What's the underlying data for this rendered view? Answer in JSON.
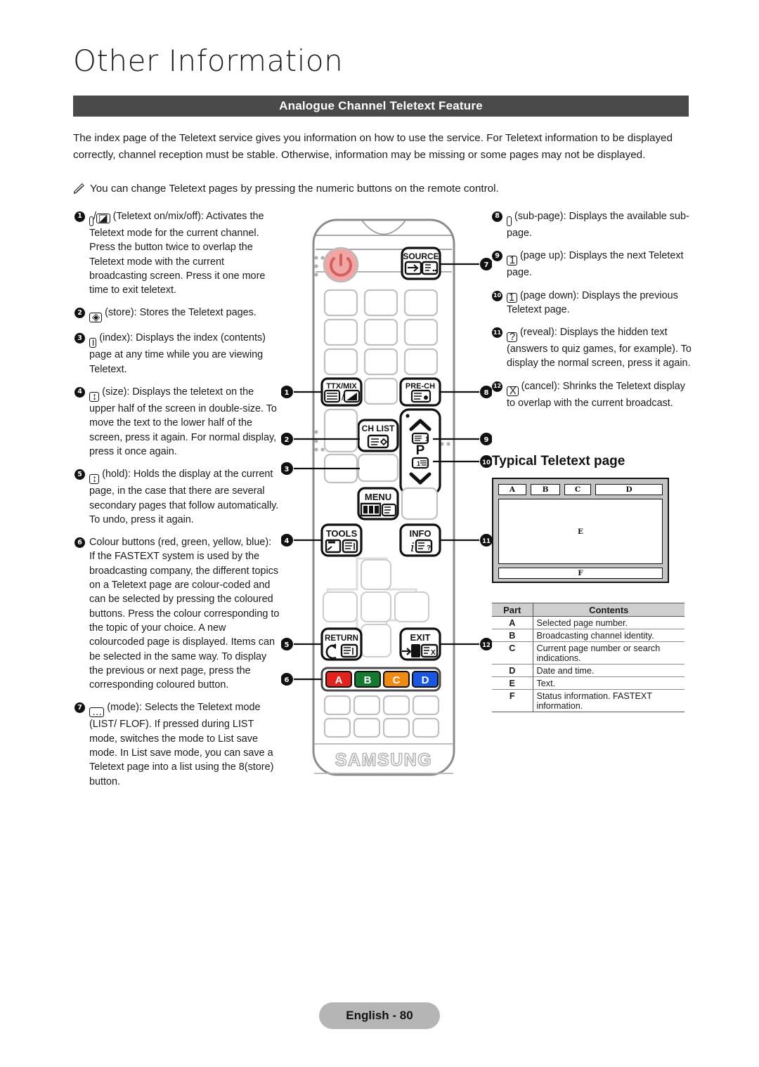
{
  "header": {
    "chapter_title": "Other Information",
    "section_title": "Analogue Channel Teletext Feature"
  },
  "intro": {
    "paragraph": "The index page of the Teletext service gives you information on how to use the service. For Teletext information to be displayed correctly, channel reception must be stable. Otherwise, information may be missing or some pages may not be displayed.",
    "note": "You can change Teletext pages by pressing the numeric buttons on the remote control.",
    "note_icon": "pencil-icon"
  },
  "left_column": [
    {
      "num": "1",
      "icon": "teletext-on-mix-off-icon",
      "text": "(Teletext on/mix/off): Activates the Teletext mode for the current channel. Press the button twice to overlap the Teletext mode with the current broadcasting screen. Press it one more time to exit teletext."
    },
    {
      "num": "2",
      "icon": "store-icon",
      "text": "(store): Stores the Teletext pages."
    },
    {
      "num": "3",
      "icon": "index-icon",
      "text": "(index): Displays the index (contents) page at any time while you are viewing Teletext."
    },
    {
      "num": "4",
      "icon": "size-icon",
      "text": "(size): Displays the teletext on the upper half of the screen in double-size. To move the text to the lower half of the screen, press it again. For normal display, press it once again."
    },
    {
      "num": "5",
      "icon": "hold-icon",
      "text": "(hold): Holds the display at the current page, in the case that there are several secondary pages that follow automatically. To undo, press it again."
    },
    {
      "num": "6",
      "icon": "colour-buttons-icon",
      "text": "Colour buttons (red, green, yellow, blue): If the FASTEXT system is used by the broadcasting company, the different topics on a Teletext page are colour-coded and can be selected by pressing the coloured buttons. Press the colour corresponding to the topic of your choice. A new colourcoded page is displayed. Items can be selected in the same way. To display the previous or next page, press the corresponding coloured button."
    },
    {
      "num": "7",
      "icon": "mode-icon",
      "text": "(mode): Selects the Teletext mode (LIST/ FLOF). If pressed during LIST mode, switches the mode to List save mode. In List save mode, you can save a Teletext page into a list using the 8(store) button."
    }
  ],
  "right_column": [
    {
      "num": "8",
      "icon": "sub-page-icon",
      "text": "(sub-page): Displays the available sub-page."
    },
    {
      "num": "9",
      "icon": "page-up-icon",
      "text": "(page up): Displays the next Teletext page."
    },
    {
      "num": "10",
      "icon": "page-down-icon",
      "text": "(page down): Displays the previous Teletext page."
    },
    {
      "num": "11",
      "icon": "reveal-icon",
      "text": "(reveal): Displays the hidden text (answers to quiz games, for example). To display the normal screen, press it again."
    },
    {
      "num": "12",
      "icon": "cancel-icon",
      "text": "(cancel): Shrinks the Teletext display to overlap with the current broadcast."
    }
  ],
  "typical_page": {
    "heading": "Typical Teletext page",
    "regions": {
      "a": "A",
      "b": "B",
      "c": "C",
      "d": "D",
      "e": "E",
      "f": "F"
    }
  },
  "parts_table": {
    "columns": [
      "Part",
      "Contents"
    ],
    "rows": [
      {
        "part": "A",
        "contents": "Selected page number."
      },
      {
        "part": "B",
        "contents": "Broadcasting channel identity."
      },
      {
        "part": "C",
        "contents": "Current page number or search indications."
      },
      {
        "part": "D",
        "contents": "Date and time."
      },
      {
        "part": "E",
        "contents": "Text."
      },
      {
        "part": "F",
        "contents": "Status information. FASTEXT information."
      }
    ]
  },
  "remote": {
    "brand": "SAMSUNG",
    "buttons": {
      "source": "SOURCE",
      "pre_ch": "PRE-CH",
      "ttx_mix": "TTX/MIX",
      "ch_list": "CH LIST",
      "menu": "MENU",
      "tools": "TOOLS",
      "info": "INFO",
      "return": "RETURN",
      "exit": "EXIT",
      "p_label": "P"
    },
    "colour_buttons": [
      {
        "label": "A",
        "color": "#e2221d"
      },
      {
        "label": "B",
        "color": "#13792f"
      },
      {
        "label": "C",
        "color": "#f08a12"
      },
      {
        "label": "D",
        "color": "#1a56e0"
      }
    ],
    "callouts_left": [
      "1",
      "2",
      "3",
      "4",
      "5",
      "6"
    ],
    "callouts_right": [
      "7",
      "8",
      "9",
      "10",
      "11",
      "12"
    ],
    "power_button_color": "#f2a5a5"
  },
  "footer": {
    "page_label": "English - 80"
  },
  "colors": {
    "section_bar": "#4a4a4a",
    "footer_pill": "#b5b5b5",
    "diagram_frame": "#c4c4c4",
    "table_header": "#cfcfcf"
  }
}
